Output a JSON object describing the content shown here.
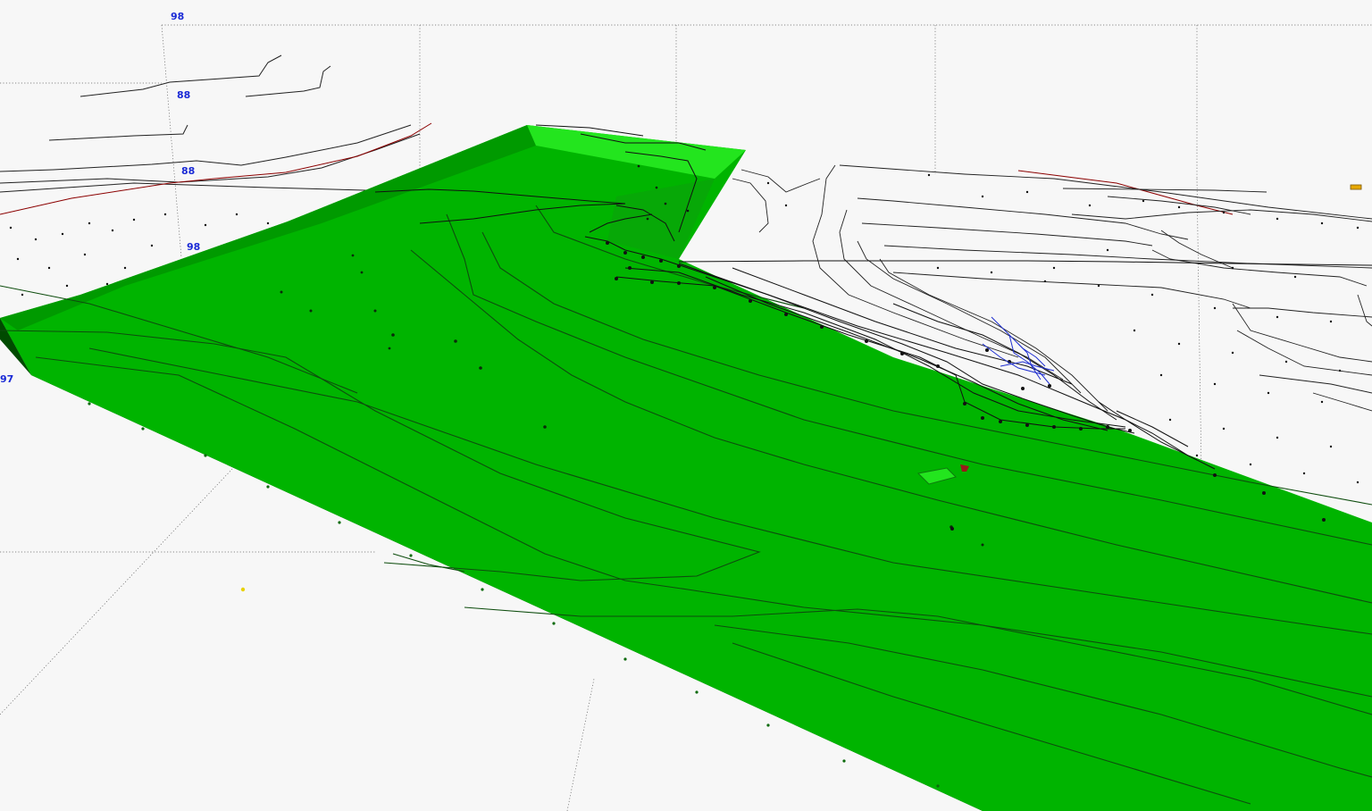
{
  "viewer": {
    "background": "#f7f7f7",
    "grid_color": "#555555",
    "terrain_top_color": "#00b400",
    "terrain_top_light_color": "#23e51e",
    "terrain_side_color": "#003f00",
    "terrain_face_color": "#028d02",
    "contour_color": "#1a1a1a",
    "boundary_color": "#8b0000",
    "well_color": "#1f2fd0",
    "axis_label_color": "#1a2ad6"
  },
  "axis_labels": [
    "98",
    "88",
    "88",
    "98",
    "97"
  ]
}
